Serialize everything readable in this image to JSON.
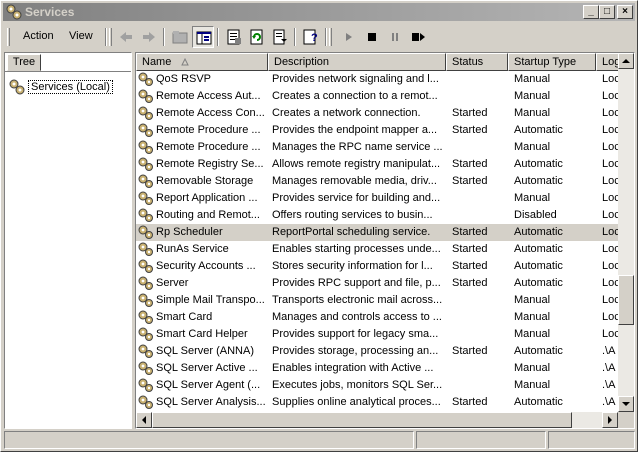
{
  "window": {
    "title": "Services"
  },
  "menu": {
    "action": "Action",
    "view": "View"
  },
  "tree": {
    "tab_label": "Tree",
    "root_label": "Services (Local)"
  },
  "columns": {
    "name": "Name",
    "description": "Description",
    "status": "Status",
    "startup": "Startup Type",
    "logon": "Log"
  },
  "services": [
    {
      "name": "QoS RSVP",
      "description": "Provides network signaling and l...",
      "status": "",
      "startup": "Manual",
      "logon": "Loc"
    },
    {
      "name": "Remote Access Aut...",
      "description": "Creates a connection to a remot...",
      "status": "",
      "startup": "Manual",
      "logon": "Loc"
    },
    {
      "name": "Remote Access Con...",
      "description": "Creates a network connection.",
      "status": "Started",
      "startup": "Manual",
      "logon": "Loc"
    },
    {
      "name": "Remote Procedure ...",
      "description": "Provides the endpoint mapper a...",
      "status": "Started",
      "startup": "Automatic",
      "logon": "Loc"
    },
    {
      "name": "Remote Procedure ...",
      "description": "Manages the RPC name service ...",
      "status": "",
      "startup": "Manual",
      "logon": "Loc"
    },
    {
      "name": "Remote Registry Se...",
      "description": "Allows remote registry manipulat...",
      "status": "Started",
      "startup": "Automatic",
      "logon": "Loc"
    },
    {
      "name": "Removable Storage",
      "description": "Manages removable media, driv...",
      "status": "Started",
      "startup": "Automatic",
      "logon": "Loc"
    },
    {
      "name": "Report Application ...",
      "description": "Provides service for building and...",
      "status": "",
      "startup": "Manual",
      "logon": "Loc"
    },
    {
      "name": "Routing and Remot...",
      "description": "Offers routing services to busin...",
      "status": "",
      "startup": "Disabled",
      "logon": "Loc"
    },
    {
      "name": "Rp Scheduler",
      "description": "ReportPortal scheduling service.",
      "status": "Started",
      "startup": "Automatic",
      "logon": "Loc",
      "selected": true
    },
    {
      "name": "RunAs Service",
      "description": "Enables starting processes unde...",
      "status": "Started",
      "startup": "Automatic",
      "logon": "Loc"
    },
    {
      "name": "Security Accounts ...",
      "description": "Stores security information for l...",
      "status": "Started",
      "startup": "Automatic",
      "logon": "Loc"
    },
    {
      "name": "Server",
      "description": "Provides RPC support and file, p...",
      "status": "Started",
      "startup": "Automatic",
      "logon": "Loc"
    },
    {
      "name": "Simple Mail Transpo...",
      "description": "Transports electronic mail across...",
      "status": "",
      "startup": "Manual",
      "logon": "Loc"
    },
    {
      "name": "Smart Card",
      "description": "Manages and controls access to ...",
      "status": "",
      "startup": "Manual",
      "logon": "Loc"
    },
    {
      "name": "Smart Card Helper",
      "description": "Provides support for legacy sma...",
      "status": "",
      "startup": "Manual",
      "logon": "Loc"
    },
    {
      "name": "SQL Server (ANNA)",
      "description": "Provides storage, processing an...",
      "status": "Started",
      "startup": "Automatic",
      "logon": ".\\A"
    },
    {
      "name": "SQL Server Active ...",
      "description": "Enables integration with Active ...",
      "status": "",
      "startup": "Manual",
      "logon": ".\\A"
    },
    {
      "name": "SQL Server Agent (...",
      "description": "Executes jobs, monitors SQL Ser...",
      "status": "",
      "startup": "Manual",
      "logon": ".\\A"
    },
    {
      "name": "SQL Server Analysis...",
      "description": "Supplies online analytical proces...",
      "status": "Started",
      "startup": "Automatic",
      "logon": ".\\A"
    }
  ]
}
